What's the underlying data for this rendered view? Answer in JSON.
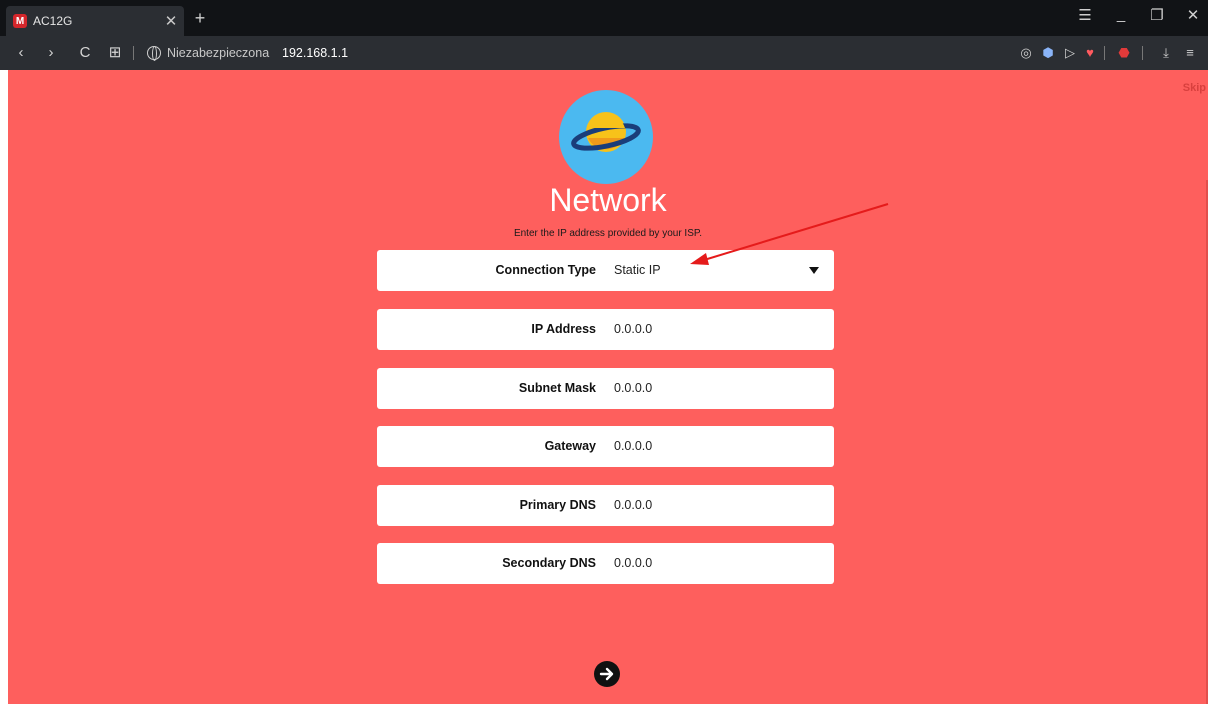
{
  "browser": {
    "tab": {
      "title": "AC12G",
      "favicon_letter": "M",
      "close_glyph": "✕"
    },
    "new_tab_glyph": "+",
    "window_controls": {
      "menu": "☰",
      "minimize": "_",
      "restore": "❐",
      "close": "✕"
    },
    "nav": {
      "back": "‹",
      "forward": "›",
      "reload": "C",
      "tabs_grid": "⊞"
    },
    "security_label": "Niezabezpieczona",
    "url": "192.168.1.1"
  },
  "page": {
    "skip_label": "Skip",
    "title": "Network",
    "subtitle": "Enter the IP address provided by your ISP.",
    "connection": {
      "label": "Connection Type",
      "value": "Static IP"
    },
    "fields": [
      {
        "label": "IP Address",
        "value": "0.0.0.0"
      },
      {
        "label": "Subnet Mask",
        "value": "0.0.0.0"
      },
      {
        "label": "Gateway",
        "value": "0.0.0.0"
      },
      {
        "label": "Primary DNS",
        "value": "0.0.0.0"
      },
      {
        "label": "Secondary DNS",
        "value": "0.0.0.0"
      }
    ]
  },
  "colors": {
    "page_background": "#fe5f5d",
    "planet": "#4bb9f0",
    "planet_body": "#f7c21a",
    "annotation_arrow": "#e51b1b"
  }
}
